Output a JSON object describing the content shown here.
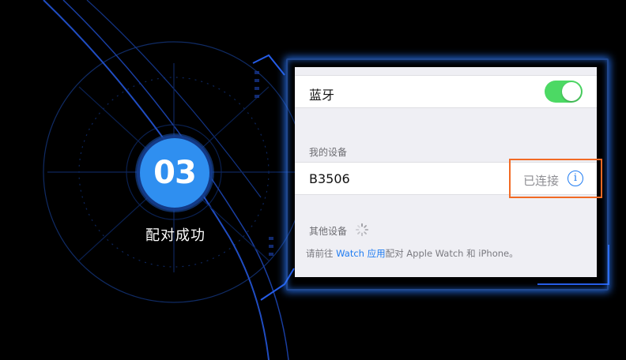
{
  "step": {
    "number": "03",
    "title": "配对成功"
  },
  "settings": {
    "bluetooth": {
      "label": "蓝牙",
      "enabled": true
    },
    "my_devices": {
      "header": "我的设备",
      "items": [
        {
          "name": "B3506",
          "status": "已连接",
          "icon": "info-icon"
        }
      ]
    },
    "other_devices": {
      "header": "其他设备",
      "icon": "spinner-icon"
    },
    "footer": {
      "prefix": "请前往",
      "link": "Watch 应用",
      "suffix": "配对 Apple Watch 和 iPhone。"
    }
  },
  "colors": {
    "accent": "#2f8ff0",
    "toggle_on": "#4cd964",
    "link": "#1f7cf2",
    "highlight": "#f26a24"
  }
}
